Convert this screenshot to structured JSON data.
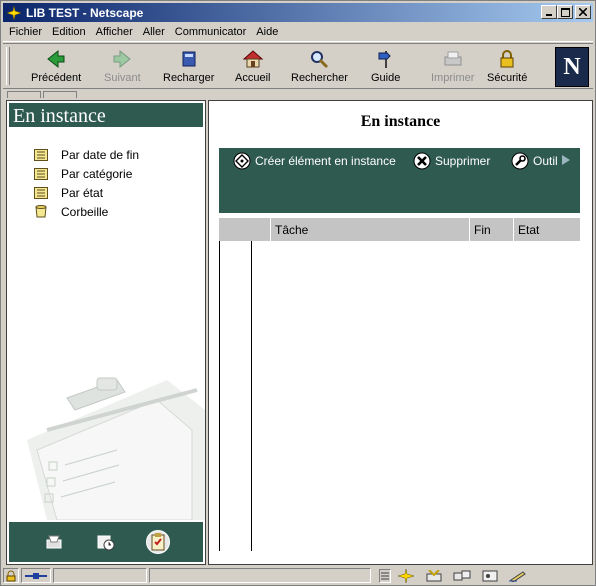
{
  "window": {
    "title": "LIB TEST - Netscape",
    "buttons": {
      "minimize": "_",
      "maximize": "□",
      "close": "×"
    }
  },
  "menu": [
    {
      "label": "Fichier"
    },
    {
      "label": "Edition"
    },
    {
      "label": "Afficher"
    },
    {
      "label": "Aller"
    },
    {
      "label": "Communicator"
    },
    {
      "label": "Aide"
    }
  ],
  "toolbar": {
    "back": "Précédent",
    "forward": "Suivant",
    "reload": "Recharger",
    "home": "Accueil",
    "search": "Rechercher",
    "guide": "Guide",
    "print": "Imprimer",
    "security": "Sécurité",
    "logo": "N"
  },
  "sidebar": {
    "title": "En instance",
    "links": [
      {
        "label": "Par date de fin",
        "icon": "list-icon"
      },
      {
        "label": "Par catégorie",
        "icon": "list-icon"
      },
      {
        "label": "Par état",
        "icon": "list-icon"
      },
      {
        "label": "Corbeille",
        "icon": "trash-icon"
      }
    ]
  },
  "main": {
    "title": "En instance",
    "actions": {
      "create": "Créer élément en instance",
      "delete": "Supprimer",
      "tool": "Outil"
    },
    "columns": [
      "",
      "Tâche",
      "Fin",
      "Etat"
    ]
  },
  "colors": {
    "accent": "#2f5a50",
    "titlebar": "#0a246a",
    "header_gray": "#c4c4c4"
  }
}
